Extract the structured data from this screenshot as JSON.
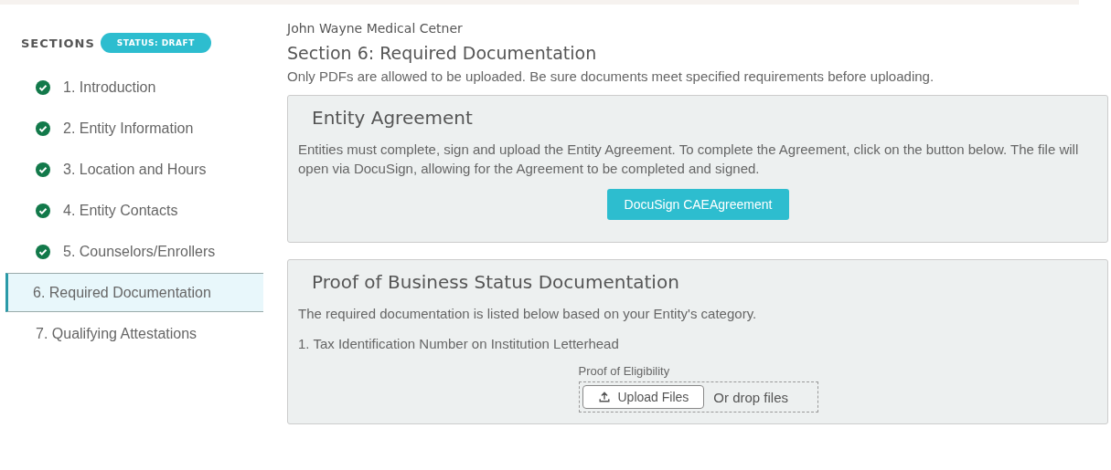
{
  "sidebar": {
    "heading": "SECTIONS",
    "status": "STATUS: DRAFT",
    "items": [
      {
        "label": "1. Introduction",
        "completed": true,
        "selected": false
      },
      {
        "label": "2. Entity Information",
        "completed": true,
        "selected": false
      },
      {
        "label": "3. Location and Hours",
        "completed": true,
        "selected": false
      },
      {
        "label": "4. Entity Contacts",
        "completed": true,
        "selected": false
      },
      {
        "label": "5. Counselors/Enrollers",
        "completed": true,
        "selected": false
      },
      {
        "label": "6. Required Documentation",
        "completed": false,
        "selected": true
      },
      {
        "label": "7. Qualifying Attestations",
        "completed": false,
        "selected": false
      }
    ]
  },
  "main": {
    "organization": "John Wayne Medical Cetner",
    "title": "Section 6: Required Documentation",
    "note": "Only PDFs are allowed to be uploaded. Be sure documents meet specified requirements before uploading.",
    "panels": [
      {
        "kind": "button",
        "title": "Entity Agreement",
        "paragraphs": [
          "Entities must complete, sign and upload the Entity Agreement. To complete the Agreement, click on the button below. The file will open via DocuSign, allowing for the Agreement to be completed and signed."
        ],
        "button": "DocuSign CAEAgreement"
      },
      {
        "kind": "upload",
        "title": "Proof of Business Status Documentation",
        "paragraphs": [
          "The required documentation is listed below based on your Entity's category.",
          "1. Tax Identification Number on Institution Letterhead"
        ],
        "upload_label": "Proof of Eligibility",
        "upload_button": "Upload Files",
        "drop_hint": "Or drop files"
      }
    ]
  }
}
